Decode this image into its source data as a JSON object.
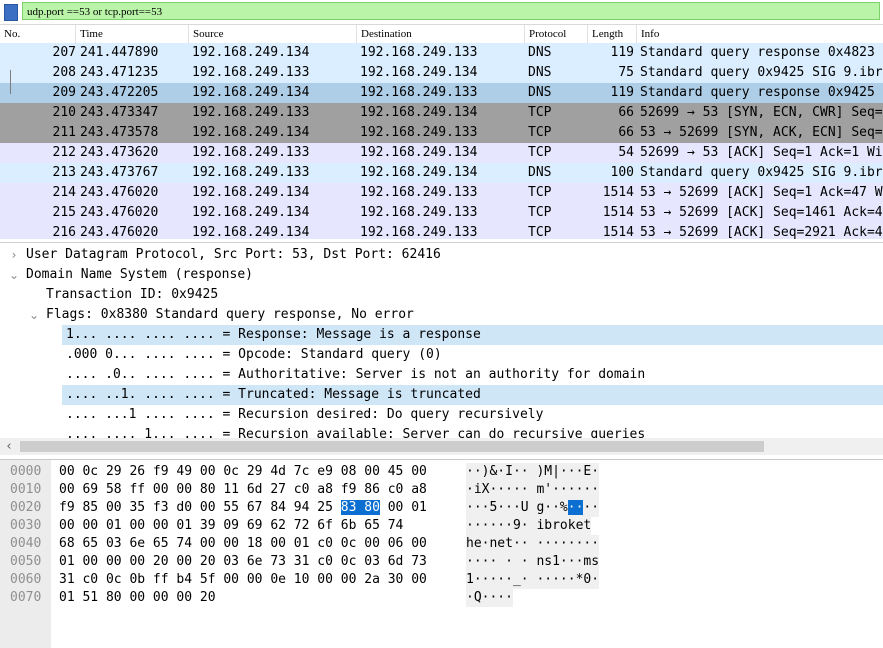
{
  "filter": {
    "text": "udp.port ==53 or tcp.port==53"
  },
  "packet_list": {
    "columns": [
      "No.",
      "Time",
      "Source",
      "Destination",
      "Protocol",
      "Length",
      "Info"
    ],
    "rows": [
      {
        "no": "207",
        "time": "241.447890",
        "src": "192.168.249.134",
        "dst": "192.168.249.133",
        "proto": "DNS",
        "len": "119",
        "info": "Standard query response 0x4823"
      },
      {
        "no": "208",
        "time": "243.471235",
        "src": "192.168.249.133",
        "dst": "192.168.249.134",
        "proto": "DNS",
        "len": "75",
        "info": "Standard query 0x9425 SIG 9.ibr"
      },
      {
        "no": "209",
        "time": "243.472205",
        "src": "192.168.249.134",
        "dst": "192.168.249.133",
        "proto": "DNS",
        "len": "119",
        "info": "Standard query response 0x9425"
      },
      {
        "no": "210",
        "time": "243.473347",
        "src": "192.168.249.133",
        "dst": "192.168.249.134",
        "proto": "TCP",
        "len": "66",
        "info": "52699 → 53 [SYN, ECN, CWR] Seq="
      },
      {
        "no": "211",
        "time": "243.473578",
        "src": "192.168.249.134",
        "dst": "192.168.249.133",
        "proto": "TCP",
        "len": "66",
        "info": "53 → 52699 [SYN, ACK, ECN] Seq="
      },
      {
        "no": "212",
        "time": "243.473620",
        "src": "192.168.249.133",
        "dst": "192.168.249.134",
        "proto": "TCP",
        "len": "54",
        "info": "52699 → 53 [ACK] Seq=1 Ack=1 Wi"
      },
      {
        "no": "213",
        "time": "243.473767",
        "src": "192.168.249.133",
        "dst": "192.168.249.134",
        "proto": "DNS",
        "len": "100",
        "info": "Standard query 0x9425 SIG 9.ibr"
      },
      {
        "no": "214",
        "time": "243.476020",
        "src": "192.168.249.134",
        "dst": "192.168.249.133",
        "proto": "TCP",
        "len": "1514",
        "info": "53 → 52699 [ACK] Seq=1 Ack=47 W"
      },
      {
        "no": "215",
        "time": "243.476020",
        "src": "192.168.249.134",
        "dst": "192.168.249.133",
        "proto": "TCP",
        "len": "1514",
        "info": "53 → 52699 [ACK] Seq=1461 Ack=4"
      },
      {
        "no": "216",
        "time": "243.476020",
        "src": "192.168.249.134",
        "dst": "192.168.249.133",
        "proto": "TCP",
        "len": "1514",
        "info": "53 → 52699 [ACK] Seq=2921 Ack=4"
      }
    ],
    "row_colors": [
      "#daeeff",
      "#daeeff",
      "#aecde6",
      "#a0a0a0",
      "#a0a0a0",
      "#e7e6ff",
      "#daeeff",
      "#e7e6ff",
      "#e7e6ff",
      "#e7e6ff"
    ]
  },
  "details": {
    "rows": [
      {
        "arrow": "›",
        "text": "User Datagram Protocol, Src Port: 53, Dst Port: 62416"
      },
      {
        "arrow": "⌄",
        "text": "Domain Name System (response)"
      },
      {
        "arrow": "",
        "text": "Transaction ID: 0x9425"
      },
      {
        "arrow": "⌄",
        "text": "Flags: 0x8380 Standard query response, No error"
      },
      {
        "arrow": "",
        "text": "1... .... .... .... = Response: Message is a response"
      },
      {
        "arrow": "",
        "text": ".000 0... .... .... = Opcode: Standard query (0)"
      },
      {
        "arrow": "",
        "text": ".... .0.. .... .... = Authoritative: Server is not an authority for domain"
      },
      {
        "arrow": "",
        "text": ".... ..1. .... .... = Truncated: Message is truncated"
      },
      {
        "arrow": "",
        "text": ".... ...1 .... .... = Recursion desired: Do query recursively"
      },
      {
        "arrow": "",
        "text": ".... .... 1... .... = Recursion available: Server can do recursive queries"
      }
    ],
    "highlight_color": "#cfe6f7"
  },
  "bytes": {
    "rows": [
      {
        "offset": "0000",
        "hex_a": "00 0c 29 26 f9 49 00 0c  29 4d 7c e9 08 00 45 00",
        "hex_sel": "",
        "hex_b": "",
        "ascii_a": "··)&·I·· )M|···E·",
        "ascii_sel": "",
        "ascii_b": ""
      },
      {
        "offset": "0010",
        "hex_a": "00 69 58 ff 00 00 80 11  6d 27 c0 a8 f9 86 c0 a8",
        "hex_sel": "",
        "hex_b": "",
        "ascii_a": "·iX····· m'······",
        "ascii_sel": "",
        "ascii_b": ""
      },
      {
        "offset": "0020",
        "hex_a": "f9 85 00 35 f3 d0 00 55  67 84 94 25 ",
        "hex_sel": "83 80",
        "hex_b": " 00 01",
        "ascii_a": "···5···U g··%",
        "ascii_sel": "··",
        "ascii_b": "··"
      },
      {
        "offset": "0030",
        "hex_a": "00 00 01 00 00 01 39 09  69 62 72 6f 6b 65 74",
        "hex_sel": "",
        "hex_b": "",
        "ascii_a": "······9· ibroket",
        "ascii_sel": "",
        "ascii_b": ""
      },
      {
        "offset": "0040",
        "hex_a": "68 65 03 6e 65 74 00 00  18 00 01 c0 0c 00 06 00",
        "hex_sel": "",
        "hex_b": "",
        "ascii_a": "he·net·· ········",
        "ascii_sel": "",
        "ascii_b": ""
      },
      {
        "offset": "0050",
        "hex_a": "01 00 00 00 20 00 20 03  6e 73 31 c0 0c 03 6d 73",
        "hex_sel": "",
        "hex_b": "",
        "ascii_a": "···· · · ns1···ms",
        "ascii_sel": "",
        "ascii_b": ""
      },
      {
        "offset": "0060",
        "hex_a": "31 c0 0c 0b ff b4 5f 00  00 0e 10 00 00 2a 30 00",
        "hex_sel": "",
        "hex_b": "",
        "ascii_a": "1·····_· ·····*0·",
        "ascii_sel": "",
        "ascii_b": ""
      },
      {
        "offset": "0070",
        "hex_a": "01 51 80 00 00 00 20",
        "hex_sel": "",
        "hex_b": "",
        "ascii_a": "·Q····",
        "ascii_sel": "",
        "ascii_b": ""
      }
    ],
    "selection_color": "#0a6fd0"
  }
}
